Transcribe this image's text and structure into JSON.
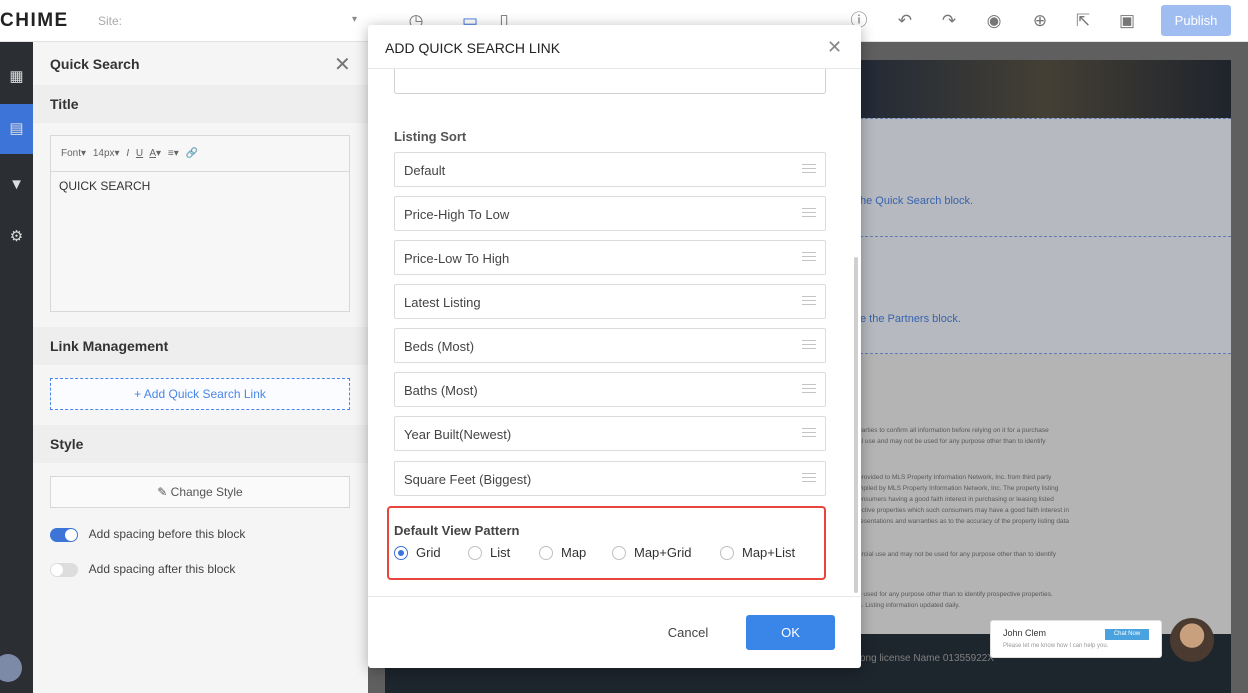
{
  "topbar": {
    "logo": "CHIME",
    "site_label": "Site:",
    "publish_label": "Publish",
    "icons": [
      "history-icon",
      "desktop-icon",
      "mobile-icon",
      "help-icon",
      "undo-icon",
      "redo-icon",
      "preview-eye-icon",
      "globe-icon",
      "export-icon",
      "save-icon"
    ]
  },
  "panel": {
    "title": "Quick Search",
    "title_section": "Title",
    "editor_toolbar": {
      "font": "Font",
      "size": "14px",
      "italic": "I",
      "underline": "U",
      "color": "A",
      "align": "≡",
      "link": "🔗"
    },
    "editor_text": "QUICK SEARCH",
    "link_management": "Link Management",
    "add_link": "+ Add Quick Search Link",
    "style_section": "Style",
    "change_style": "Change Style",
    "spacing_before": "Add spacing before this block",
    "spacing_after": "Add spacing after this block"
  },
  "canvas": {
    "hint_quick_search": "he Quick Search block.",
    "hint_partners": "e the Partners block.",
    "fine_print_1": "parties to confirm all information before relying on it for a purchase\nal use and may not be used for any purpose other than to identify",
    "fine_print_2": "provided to MLS Property Information Network, Inc. from third party\nmpiled by MLS Property Information Network, Inc. The property listing\nonsumers having a good faith interest in purchasing or leasing listed\nective properties which such consumers may have a good faith interest in\nresentations and warranties as to the accuracy of the property listing data",
    "fine_print_3": "ercial use and may not be used for any purpose other than to identify",
    "fine_print_4": "e used for any purpose other than to identify prospective properties.\ne. Listing information updated daily.",
    "footer_text": "ong license Name 01355922X",
    "chat_name": "John Clem",
    "chat_button": "Chat Now",
    "chat_message": "Please let me know how I can help you."
  },
  "modal": {
    "title": "ADD QUICK SEARCH LINK",
    "listing_sort_label": "Listing Sort",
    "sort_options": [
      "Default",
      "Price-High To Low",
      "Price-Low To High",
      "Latest Listing",
      "Beds (Most)",
      "Baths (Most)",
      "Year Built(Newest)",
      "Square Feet (Biggest)"
    ],
    "view_pattern_label": "Default View Pattern",
    "view_options": [
      "Grid",
      "List",
      "Map",
      "Map+Grid",
      "Map+List"
    ],
    "selected_view": "Grid",
    "cancel_label": "Cancel",
    "ok_label": "OK"
  },
  "colors": {
    "accent": "#3d74d8",
    "highlight_border": "#e8453c",
    "ok_button": "#3a86e8"
  }
}
